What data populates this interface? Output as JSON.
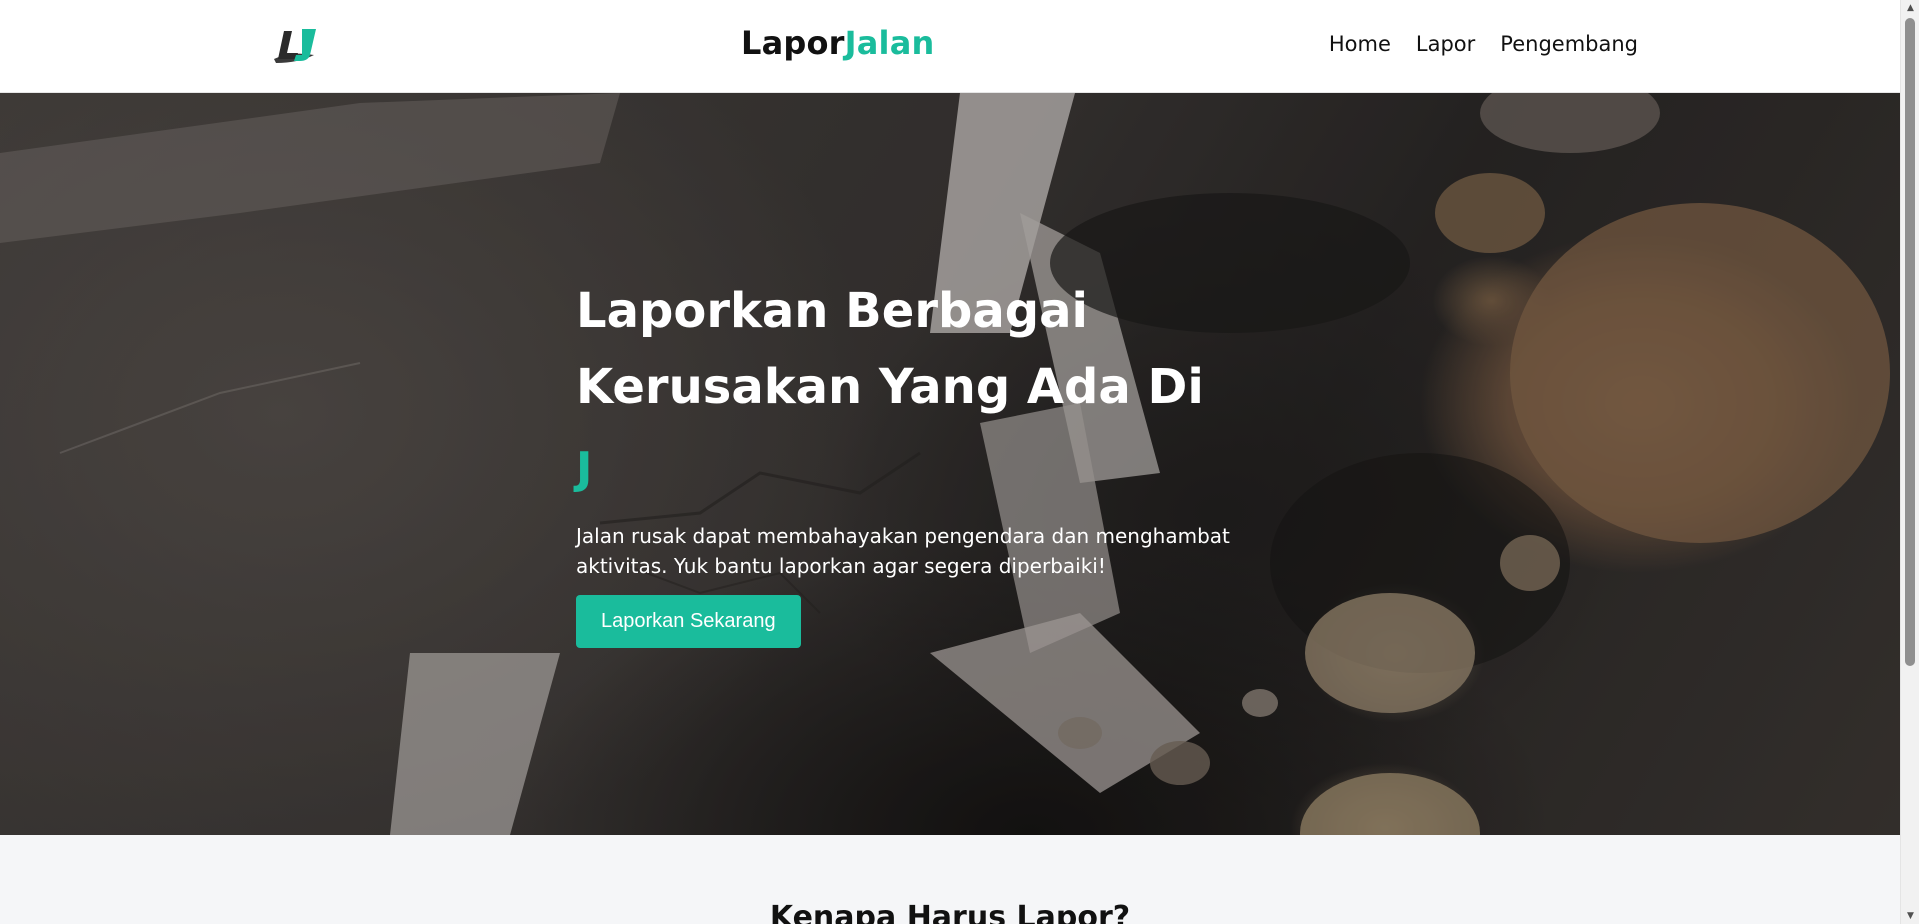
{
  "navbar": {
    "logo_text": "LJ",
    "brand_part1": "Lapor",
    "brand_part2": "Jalan",
    "links": [
      {
        "label": "Home"
      },
      {
        "label": "Lapor"
      },
      {
        "label": "Pengembang"
      }
    ]
  },
  "hero": {
    "title_line1": "Laporkan Berbagai",
    "title_line2": "Kerusakan Yang Ada Di",
    "typed_text": "J",
    "description": "Jalan rusak dapat membahayakan pengendara dan menghambat aktivitas. Yuk bantu laporkan agar segera diperbaiki!",
    "cta_label": "Laporkan Sekarang"
  },
  "section": {
    "title": "Kenapa Harus Lapor?"
  },
  "colors": {
    "accent": "#1abc9c",
    "text_dark": "#111111",
    "hero_text": "#ffffff",
    "page_bg": "#f5f6f8"
  }
}
